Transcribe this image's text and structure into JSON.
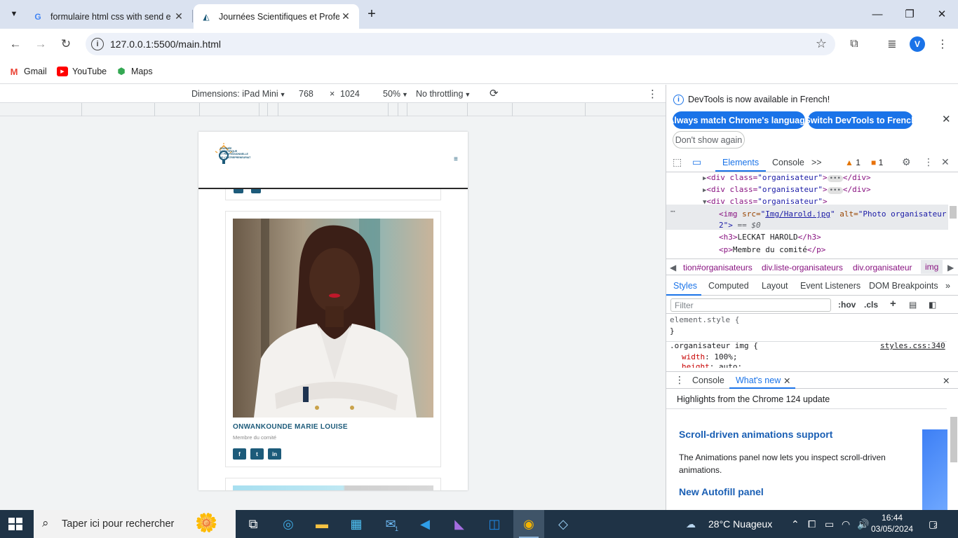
{
  "browser": {
    "tabs": [
      {
        "title": "formulaire html css with send e",
        "favicon": "google-g-icon"
      },
      {
        "title": "Journées Scientifiques et Profes",
        "favicon": "site-favicon"
      }
    ],
    "url": "127.0.0.1:5500/main.html",
    "profile_initial": "V",
    "bookmarks": [
      "Gmail",
      "YouTube",
      "Maps"
    ]
  },
  "device_toolbar": {
    "dimensions_label": "Dimensions: iPad Mini",
    "width": "768",
    "times": "×",
    "height": "1024",
    "zoom": "50%",
    "throttling": "No throttling"
  },
  "site": {
    "logo_lines": [
      "JOURNÉE",
      "SCIENTIFIQUE",
      "ET PROFESSIONNELLE",
      "DE L'ENTREPRENEURIAT"
    ],
    "menu_icon": "≡",
    "organizer": {
      "name": "ONWANKOUNDE MARIE LOUISE",
      "role": "Membre du comité",
      "social": [
        "f",
        "t",
        "in"
      ]
    }
  },
  "devtools": {
    "infobar": {
      "message": "DevTools is now available in French!",
      "btn_match": "Always match Chrome's language",
      "btn_switch": "Switch DevTools to French",
      "btn_dismiss": "Don't show again"
    },
    "tabs": {
      "elements": "Elements",
      "console": "Console",
      "more": ">>",
      "warnings": "1",
      "errors": "1"
    },
    "dom": {
      "line1_tag": "<div class=",
      "line1_val": "\"organisateur\"",
      "line1_close": "</div>",
      "line3_val": "\"organisateur\"",
      "img_src_attr": "src=",
      "img_src": "Img/Harold.jpg",
      "img_alt_attr": "alt=",
      "img_alt": "\"Photo organisateur",
      "img_alt2": "2\">",
      "eq": "== $0",
      "h3": "LECKAT HAROLD",
      "p": "Membre du comité"
    },
    "breadcrumbs": [
      "tion#organisateurs",
      "div.liste-organisateurs",
      "div.organisateur",
      "img"
    ],
    "subtabs": [
      "Styles",
      "Computed",
      "Layout",
      "Event Listeners",
      "DOM Breakpoints"
    ],
    "filter_placeholder": "Filter",
    "filter_hov": ":hov",
    "filter_cls": ".cls",
    "styles": {
      "element_style": "element.style {",
      "close_brace": "}",
      "rule_selector": ".organisateur img {",
      "rule_source": "styles.css:340",
      "prop1": "width",
      "val1": "100%;",
      "prop2": "height",
      "val2": "auto;"
    },
    "drawer": {
      "console_tab": "Console",
      "whatsnew_tab": "What's new",
      "highlights": "Highlights from the Chrome 124 update",
      "h1": "Scroll-driven animations support",
      "p1": "The Animations panel now lets you inspect scroll-driven animations.",
      "h2": "New Autofill panel"
    }
  },
  "taskbar": {
    "search_placeholder": "Taper ici pour rechercher",
    "weather": "28°C  Nuageux",
    "time": "16:44",
    "date": "03/05/2024",
    "notification_count": "2",
    "mail_badge": "1"
  }
}
